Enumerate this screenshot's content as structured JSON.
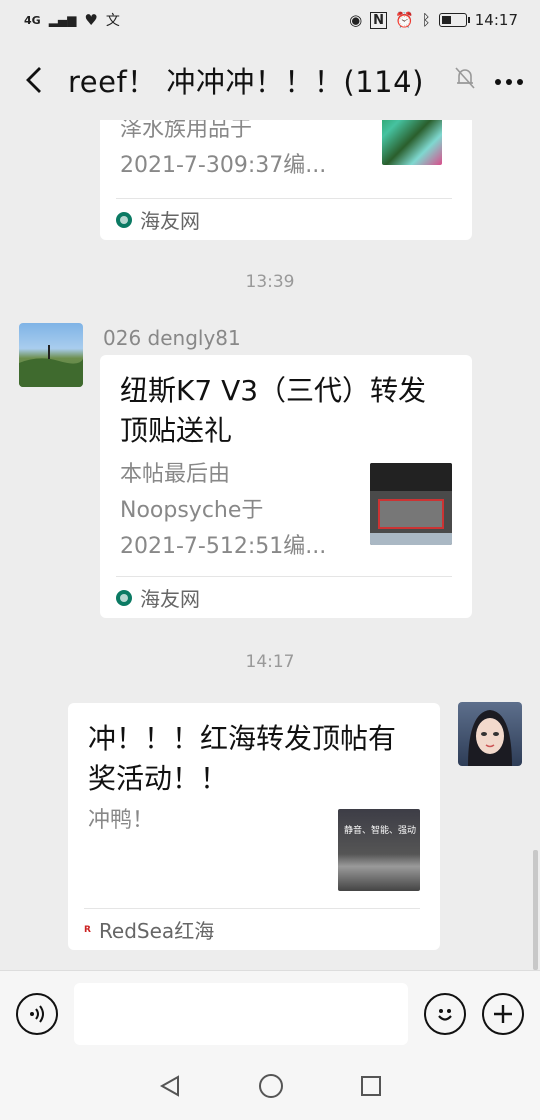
{
  "status": {
    "network": "4G",
    "time": "14:17"
  },
  "header": {
    "title": "reef！ 冲冲冲！！！(114)"
  },
  "messages": {
    "card1": {
      "desc_line1": "泽水族用品于",
      "desc_line2": "2021-7-309:37编...",
      "source": "海友网"
    },
    "time1": "13:39",
    "msg2": {
      "sender": "026 dengly81",
      "title_line1": "纽斯K7 V3（三代）转发",
      "title_line2": "顶贴送礼",
      "desc_line1": "本帖最后由",
      "desc_line2": "Noopsyche于",
      "desc_line3": "2021-7-512:51编...",
      "source": "海友网"
    },
    "time2": "14:17",
    "msg3": {
      "title_line1": "冲！！！红海转发顶帖有",
      "title_line2": "奖活动！！",
      "desc": "冲鸭！",
      "source": "RedSea红海",
      "thumb_text": "静音、智能、强动"
    }
  },
  "icons": [
    "back-icon",
    "mute-bell-icon",
    "more-icon",
    "voice-icon",
    "emoji-icon",
    "add-icon",
    "nav-back-icon",
    "nav-home-icon",
    "nav-recents-icon"
  ]
}
